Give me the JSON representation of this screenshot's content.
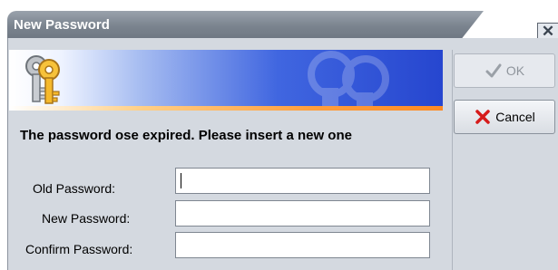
{
  "window": {
    "title": "New Password",
    "close_glyph": "✕"
  },
  "banner": {
    "icon": "keys-icon"
  },
  "message": "The password ose expired. Please insert a new one",
  "form": {
    "old_password_label": "Old Password:",
    "new_password_label": "New Password:",
    "confirm_password_label": "Confirm Password:",
    "old_password_value": "",
    "new_password_value": "",
    "confirm_password_value": ""
  },
  "buttons": {
    "ok_label": "OK",
    "ok_icon": "checkmark-icon",
    "ok_enabled": false,
    "cancel_label": "Cancel",
    "cancel_icon": "red-x-icon"
  },
  "colors": {
    "banner_blue": "#2646cf",
    "panel_gray": "#d4d9e0",
    "titlebar_gray": "#7b848f",
    "cancel_red": "#d61b1b"
  }
}
